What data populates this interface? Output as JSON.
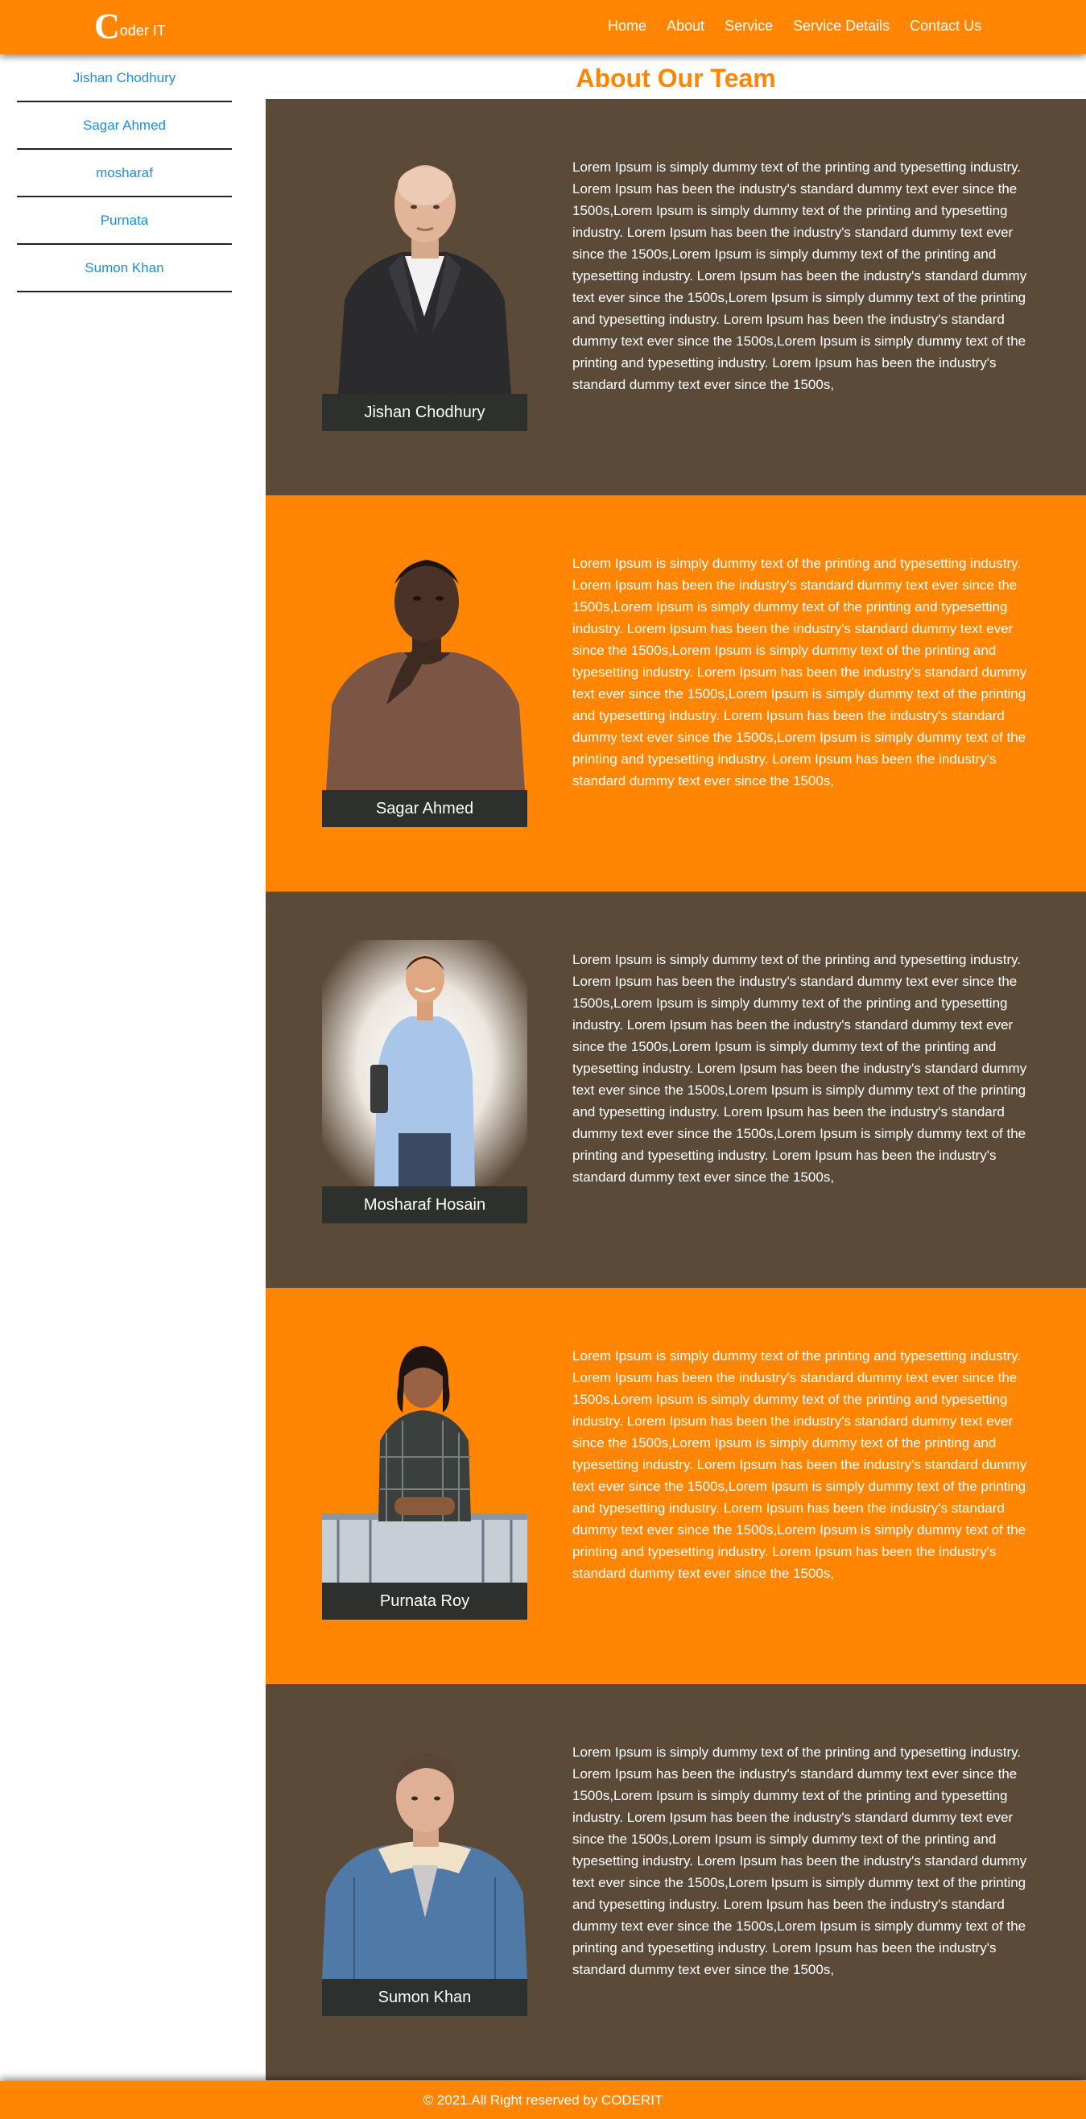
{
  "brand": {
    "logo_initial": "C",
    "logo_rest": "oder IT"
  },
  "nav": {
    "items": [
      "Home",
      "About",
      "Service",
      "Service Details",
      "Contact Us"
    ]
  },
  "sidebar": {
    "items": [
      "Jishan Chodhury",
      "Sagar Ahmed",
      "mosharaf",
      "Purnata",
      "Sumon Khan"
    ]
  },
  "main": {
    "title": "About Our Team"
  },
  "team": [
    {
      "name": "Jishan Chodhury",
      "bio": "Lorem Ipsum is simply dummy text of the printing and typesetting industry. Lorem Ipsum has been the industry's standard dummy text ever since the 1500s,Lorem Ipsum is simply dummy text of the printing and typesetting industry. Lorem Ipsum has been the industry's standard dummy text ever since the 1500s,Lorem Ipsum is simply dummy text of the printing and typesetting industry. Lorem Ipsum has been the industry's standard dummy text ever since the 1500s,Lorem Ipsum is simply dummy text of the printing and typesetting industry. Lorem Ipsum has been the industry's standard dummy text ever since the 1500s,Lorem Ipsum is simply dummy text of the printing and typesetting industry. Lorem Ipsum has been the industry's standard dummy text ever since the 1500s,"
    },
    {
      "name": "Sagar Ahmed",
      "bio": "Lorem Ipsum is simply dummy text of the printing and typesetting industry. Lorem Ipsum has been the industry's standard dummy text ever since the 1500s,Lorem Ipsum is simply dummy text of the printing and typesetting industry. Lorem Ipsum has been the industry's standard dummy text ever since the 1500s,Lorem Ipsum is simply dummy text of the printing and typesetting industry. Lorem Ipsum has been the industry's standard dummy text ever since the 1500s,Lorem Ipsum is simply dummy text of the printing and typesetting industry. Lorem Ipsum has been the industry's standard dummy text ever since the 1500s,Lorem Ipsum is simply dummy text of the printing and typesetting industry. Lorem Ipsum has been the industry's standard dummy text ever since the 1500s,"
    },
    {
      "name": "Mosharaf Hosain",
      "bio": "Lorem Ipsum is simply dummy text of the printing and typesetting industry. Lorem Ipsum has been the industry's standard dummy text ever since the 1500s,Lorem Ipsum is simply dummy text of the printing and typesetting industry. Lorem Ipsum has been the industry's standard dummy text ever since the 1500s,Lorem Ipsum is simply dummy text of the printing and typesetting industry. Lorem Ipsum has been the industry's standard dummy text ever since the 1500s,Lorem Ipsum is simply dummy text of the printing and typesetting industry. Lorem Ipsum has been the industry's standard dummy text ever since the 1500s,Lorem Ipsum is simply dummy text of the printing and typesetting industry. Lorem Ipsum has been the industry's standard dummy text ever since the 1500s,"
    },
    {
      "name": "Purnata Roy",
      "bio": "Lorem Ipsum is simply dummy text of the printing and typesetting industry. Lorem Ipsum has been the industry's standard dummy text ever since the 1500s,Lorem Ipsum is simply dummy text of the printing and typesetting industry. Lorem Ipsum has been the industry's standard dummy text ever since the 1500s,Lorem Ipsum is simply dummy text of the printing and typesetting industry. Lorem Ipsum has been the industry's standard dummy text ever since the 1500s,Lorem Ipsum is simply dummy text of the printing and typesetting industry. Lorem Ipsum has been the industry's standard dummy text ever since the 1500s,Lorem Ipsum is simply dummy text of the printing and typesetting industry. Lorem Ipsum has been the industry's standard dummy text ever since the 1500s,"
    },
    {
      "name": "Sumon Khan",
      "bio": "Lorem Ipsum is simply dummy text of the printing and typesetting industry. Lorem Ipsum has been the industry's standard dummy text ever since the 1500s,Lorem Ipsum is simply dummy text of the printing and typesetting industry. Lorem Ipsum has been the industry's standard dummy text ever since the 1500s,Lorem Ipsum is simply dummy text of the printing and typesetting industry. Lorem Ipsum has been the industry's standard dummy text ever since the 1500s,Lorem Ipsum is simply dummy text of the printing and typesetting industry. Lorem Ipsum has been the industry's standard dummy text ever since the 1500s,Lorem Ipsum is simply dummy text of the printing and typesetting industry. Lorem Ipsum has been the industry's standard dummy text ever since the 1500s,"
    }
  ],
  "footer": {
    "text": "© 2021.All Right reserved by CODERIT"
  },
  "colors": {
    "brand_orange": "#ff8503",
    "section_brown": "#5b4a38",
    "name_bar": "#2d302c",
    "sidebar_link": "#1a8ee6"
  }
}
